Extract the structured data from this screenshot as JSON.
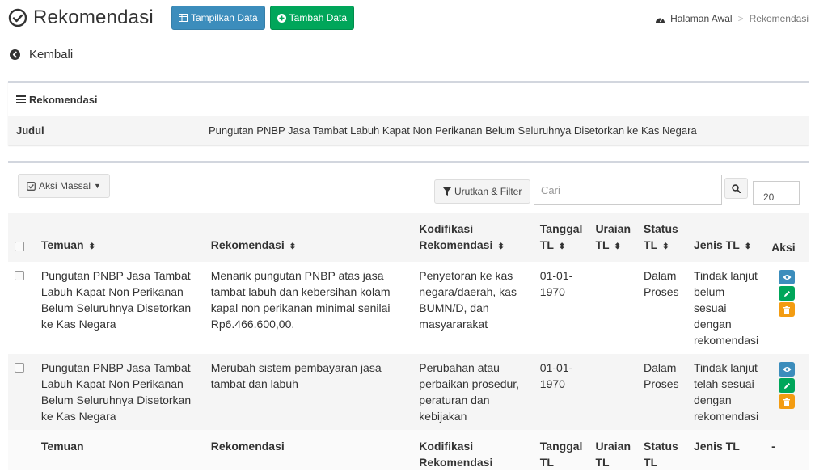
{
  "header": {
    "title": "Rekomendasi",
    "btn_show": "Tampilkan Data",
    "btn_add": "Tambah Data"
  },
  "breadcrumb": {
    "home": "Halaman Awal",
    "separator": ">",
    "current": "Rekomendasi"
  },
  "back_label": "Kembali",
  "detail_box": {
    "title": "Rekomendasi",
    "judul_label": "Judul",
    "judul_value": "Pungutan PNBP Jasa Tambat Labuh Kapat Non Perikanan Belum Seluruhnya Disetorkan ke Kas Negara"
  },
  "toolbar": {
    "mass_action": "Aksi Massal",
    "sort_filter": "Urutkan & Filter",
    "search_placeholder": "Cari",
    "per_page": "20"
  },
  "table": {
    "headers": {
      "temuan": "Temuan",
      "rekomendasi": "Rekomendasi",
      "kodifikasi_1": "Kodifikasi",
      "kodifikasi_2": "Rekomendasi",
      "tanggal_1": "Tanggal",
      "tanggal_2": "TL",
      "uraian_1": "Uraian",
      "uraian_2": "TL",
      "status_1": "Status",
      "status_2": "TL",
      "jenis": "Jenis TL",
      "aksi": "Aksi"
    },
    "sort_glyph": "⬍",
    "rows": [
      {
        "temuan": "Pungutan PNBP Jasa Tambat Labuh Kapat Non Perikanan Belum Seluruhnya Disetorkan ke Kas Negara",
        "rekomendasi": "Menarik pungutan PNBP atas jasa tambat labuh dan kebersihan kolam kapal non perikanan minimal senilai Rp6.466.600,00.",
        "kodifikasi": "Penyetoran ke kas negara/daerah, kas BUMN/D, dan masyararakat",
        "tanggal": "01-01-1970",
        "uraian": "",
        "status": "Dalam Proses",
        "jenis": "Tindak lanjut belum sesuai dengan rekomendasi"
      },
      {
        "temuan": "Pungutan PNBP Jasa Tambat Labuh Kapat Non Perikanan Belum Seluruhnya Disetorkan ke Kas Negara",
        "rekomendasi": "Merubah sistem pembayaran jasa tambat dan labuh",
        "kodifikasi": "Perubahan atau perbaikan prosedur, peraturan dan kebijakan",
        "tanggal": "01-01-1970",
        "uraian": "",
        "status": "Dalam Proses",
        "jenis": "Tindak lanjut telah sesuai dengan rekomendasi"
      }
    ],
    "footer": {
      "temuan": "Temuan",
      "rekomendasi": "Rekomendasi",
      "kodifikasi_1": "Kodifikasi",
      "kodifikasi_2": "Rekomendasi",
      "tanggal_1": "Tanggal",
      "tanggal_2": "TL",
      "uraian_1": "Uraian",
      "uraian_2": "TL",
      "status_1": "Status",
      "status_2": "TL",
      "jenis": "Jenis TL",
      "aksi": "-"
    }
  },
  "icons": {
    "title": "check-circle-icon",
    "show": "table-icon",
    "add": "plus-circle-icon",
    "home": "dashboard-icon",
    "back": "chevron-circle-left-icon",
    "box": "bars-icon",
    "mass": "check-square-icon",
    "filter": "filter-icon",
    "search": "search-icon",
    "view": "eye-icon",
    "edit": "pencil-icon",
    "delete": "trash-icon"
  },
  "colors": {
    "primary": "#3c8dbc",
    "success": "#00a65a",
    "warning": "#f39c12"
  }
}
